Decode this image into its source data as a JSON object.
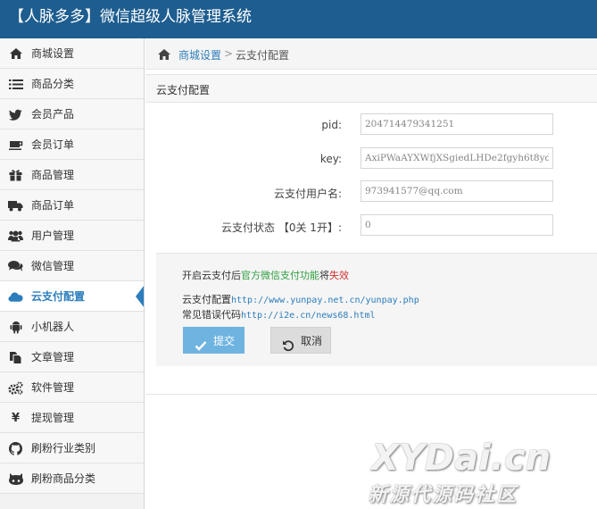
{
  "header": {
    "title": "【人脉多多】微信超级人脉管理系统"
  },
  "colors": {
    "header_bg": "#1e5d8f",
    "accent": "#2b7dbc",
    "submit_bg": "#6fb3e0",
    "green": "#2e9e3e",
    "red": "#d12f2f"
  },
  "sidebar": {
    "items": [
      {
        "label": "商城设置",
        "icon": "home-icon"
      },
      {
        "label": "商品分类",
        "icon": "list-icon"
      },
      {
        "label": "会员产品",
        "icon": "twitter-bird-icon"
      },
      {
        "label": "会员订单",
        "icon": "coffee-cup-icon"
      },
      {
        "label": "商品管理",
        "icon": "gift-icon"
      },
      {
        "label": "商品订单",
        "icon": "truck-icon"
      },
      {
        "label": "用户管理",
        "icon": "users-icon"
      },
      {
        "label": "微信管理",
        "icon": "comments-icon"
      },
      {
        "label": "云支付配置",
        "icon": "cloud-icon",
        "active": true
      },
      {
        "label": "小机器人",
        "icon": "android-icon"
      },
      {
        "label": "文章管理",
        "icon": "copy-icon"
      },
      {
        "label": "软件管理",
        "icon": "cogs-icon"
      },
      {
        "label": "提现管理",
        "icon": "yen-icon"
      },
      {
        "label": "刷粉行业类别",
        "icon": "github-icon"
      },
      {
        "label": "刷粉商品分类",
        "icon": "github-alt-icon"
      }
    ]
  },
  "breadcrumb": {
    "link": "商城设置",
    "separator": ">",
    "current": "云支付配置"
  },
  "panel": {
    "title": "云支付配置"
  },
  "form": {
    "pid": {
      "label": "pid:",
      "value": "204714479341251"
    },
    "key": {
      "label": "key:",
      "value": "AxiPWaAYXWfjXSgiedLHDe2fgyh6t8yd"
    },
    "username": {
      "label": "云支付用户名:",
      "value": "973941577@qq.com"
    },
    "status": {
      "label": "云支付状态 【0关 1开】:",
      "value": "0"
    }
  },
  "notes": {
    "line1_prefix": "开启云支付后",
    "line1_green": "官方微信支付功能",
    "line1_mid": "将",
    "line1_red": "失效",
    "line2_label": "云支付配置",
    "line2_url": "http://www.yunpay.net.cn/yunpay.php",
    "line3_label": "常见错误代码",
    "line3_url": "http://i2e.cn/news68.html"
  },
  "buttons": {
    "submit": "提交",
    "cancel": "取消"
  },
  "watermark": {
    "big": "XYDai.cn",
    "small": "新源代源码社区"
  }
}
